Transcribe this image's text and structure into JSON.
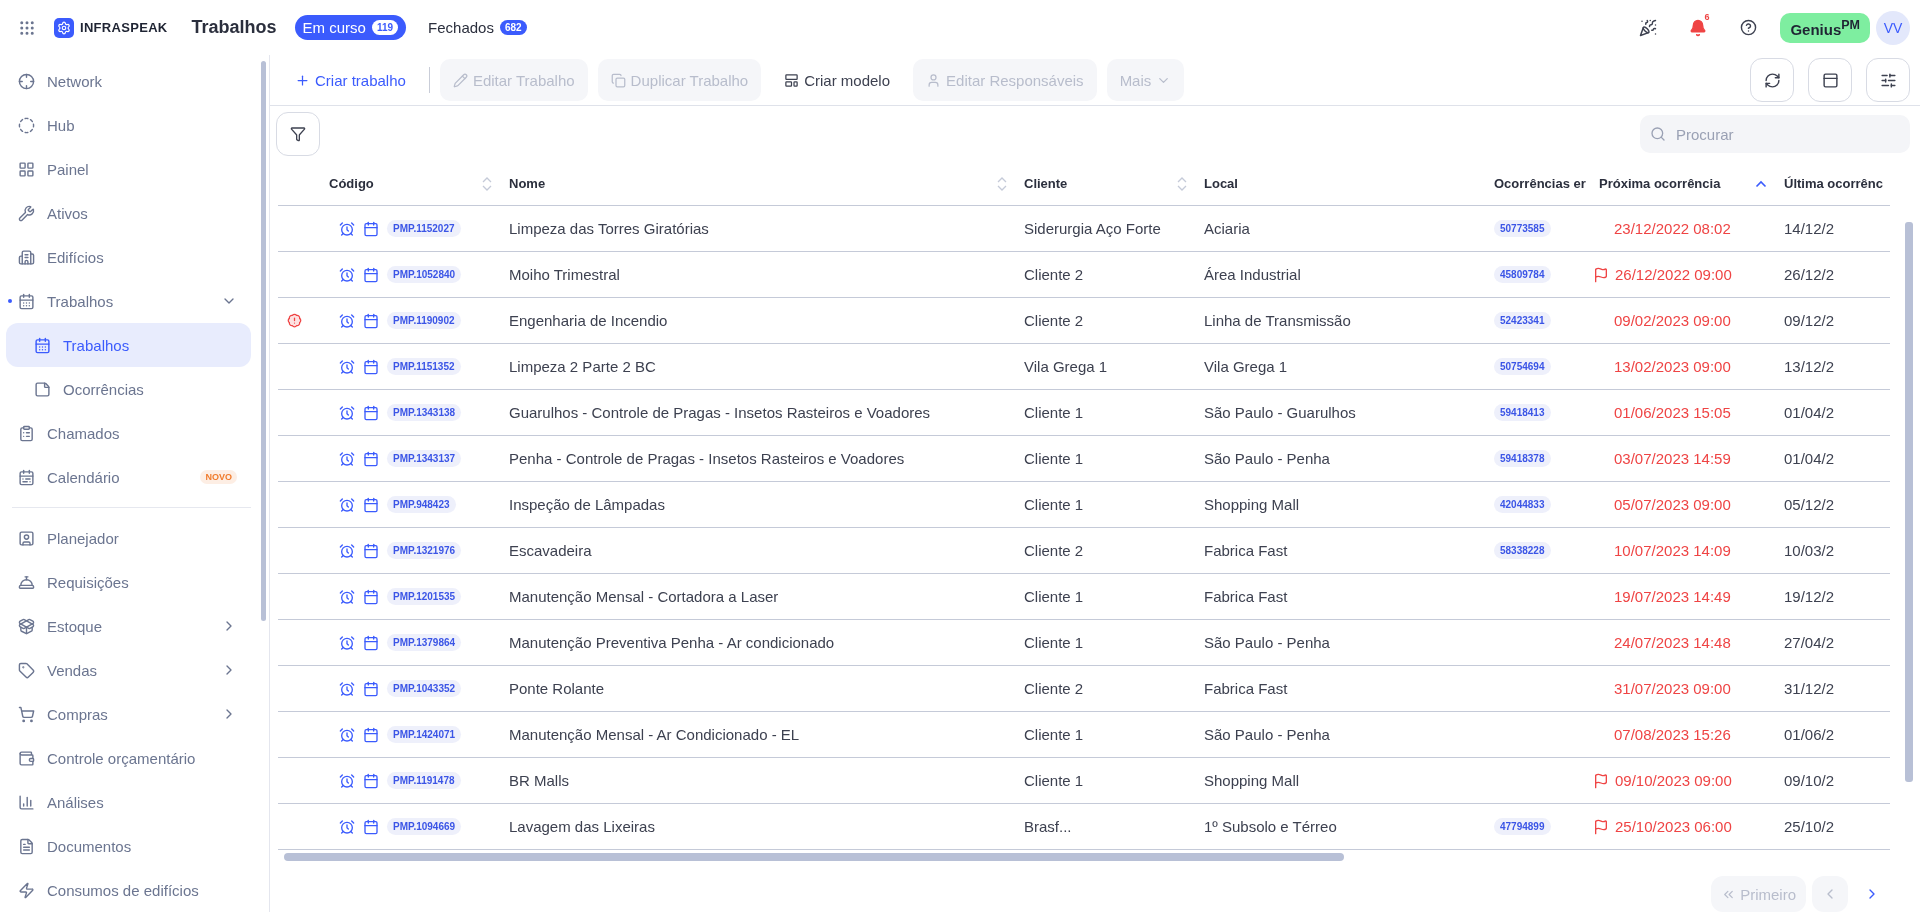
{
  "app": {
    "brand": "INFRASPEAK",
    "title": "Trabalhos"
  },
  "tabs": [
    {
      "label": "Em curso",
      "count": "119",
      "selected": true
    },
    {
      "label": "Fechados",
      "count": "682",
      "selected": false
    }
  ],
  "header_actions": {
    "notifications": "6",
    "plan": "Genius$^{PM}$",
    "avatar": "VV"
  },
  "sidebar": {
    "groups": [
      [
        {
          "label": "Network",
          "selected": false
        },
        {
          "label": "Hub",
          "selected": false
        },
        {
          "label": "Painel",
          "selected": false
        },
        {
          "label": "Ativos",
          "selected": false
        },
        {
          "label": "Edifícios",
          "selected": false
        },
        {
          "label": "Trabalhos",
          "selected": false,
          "expanded": true,
          "children": [
            {
              "label": "Trabalhos",
              "selected": true
            },
            {
              "label": "Ocorrências",
              "selected": false
            }
          ]
        },
        {
          "label": "Chamados",
          "selected": false
        },
        {
          "label": "Calendário",
          "selected": false,
          "badge": "NOVO"
        }
      ],
      [
        {
          "label": "Planejador",
          "selected": false
        },
        {
          "label": "Requisições",
          "selected": false
        },
        {
          "label": "Estoque",
          "selected": false,
          "expanded": false
        },
        {
          "label": "Vendas",
          "selected": false,
          "expanded": false
        },
        {
          "label": "Compras",
          "selected": false,
          "expanded": false
        },
        {
          "label": "Controle orçamentário",
          "selected": false
        },
        {
          "label": "Análises",
          "selected": false
        },
        {
          "label": "Documentos",
          "selected": false
        },
        {
          "label": "Consumos de edifícios",
          "selected": false
        }
      ]
    ]
  },
  "toolbar": [
    {
      "kind": "add",
      "label": "Criar trabalho",
      "disabled": false
    },
    {
      "kind": "edit",
      "label": "Editar Trabalho",
      "disabled": true
    },
    {
      "kind": "duplicate",
      "label": "Duplicar Trabalho",
      "disabled": true
    },
    {
      "kind": "template",
      "label": "Criar modelo",
      "disabled": false
    },
    {
      "kind": "assign",
      "label": "Editar Responsáveis",
      "disabled": true
    },
    {
      "kind": "more",
      "label": "Mais",
      "disabled": true
    }
  ],
  "search": {
    "placeholder": "Procurar"
  },
  "table": {
    "columns": [
      {
        "label": "Código",
        "sorted": false
      },
      {
        "label": "Nome",
        "sorted": false
      },
      {
        "label": "Cliente",
        "sorted": false
      },
      {
        "label": "Local"
      },
      {
        "label": "Ocorrências er"
      },
      {
        "label": "Próxima ocorrência",
        "sorted": true
      },
      {
        "label": "Última ocorrênc"
      }
    ],
    "rows": [
      {
        "alert": false,
        "code": "PMP.1152027",
        "name": "Limpeza das Torres Giratórias",
        "client": "Siderurgia Aço Forte",
        "location": "Aciaria",
        "occurrence": "50773585",
        "flagged": false,
        "next": "23/12/2022 08:02",
        "last": "14/12/2"
      },
      {
        "alert": false,
        "code": "PMP.1052840",
        "name": "Moiho Trimestral",
        "client": "Cliente 2",
        "location": "Área Industrial",
        "occurrence": "45809784",
        "flagged": true,
        "next": "26/12/2022 09:00",
        "last": "26/12/2"
      },
      {
        "alert": true,
        "code": "PMP.1190902",
        "name": "Engenharia de Incendio",
        "client": "Cliente 2",
        "location": "Linha de Transmissão",
        "occurrence": "52423341",
        "flagged": false,
        "next": "09/02/2023 09:00",
        "last": "09/12/2"
      },
      {
        "alert": false,
        "code": "PMP.1151352",
        "name": "Limpeza 2 Parte 2 BC",
        "client": "Vila Grega 1",
        "location": "Vila Grega 1",
        "occurrence": "50754694",
        "flagged": false,
        "next": "13/02/2023 09:00",
        "last": "13/12/2"
      },
      {
        "alert": false,
        "code": "PMP.1343138",
        "name": "Guarulhos - Controle de Pragas - Insetos Rasteiros e Voadores",
        "client": "Cliente 1",
        "location": "São Paulo - Guarulhos",
        "occurrence": "59418413",
        "flagged": false,
        "next": "01/06/2023 15:05",
        "last": "01/04/2"
      },
      {
        "alert": false,
        "code": "PMP.1343137",
        "name": "Penha - Controle de Pragas - Insetos Rasteiros e Voadores",
        "client": "Cliente 1",
        "location": "São Paulo - Penha",
        "occurrence": "59418378",
        "flagged": false,
        "next": "03/07/2023 14:59",
        "last": "01/04/2"
      },
      {
        "alert": false,
        "code": "PMP.948423",
        "name": "Inspeção de Lâmpadas",
        "client": "Cliente 1",
        "location": "Shopping Mall",
        "occurrence": "42044833",
        "flagged": false,
        "next": "05/07/2023 09:00",
        "last": "05/12/2"
      },
      {
        "alert": false,
        "code": "PMP.1321976",
        "name": "Escavadeira",
        "client": "Cliente 2",
        "location": "Fabrica Fast",
        "occurrence": "58338228",
        "flagged": false,
        "next": "10/07/2023 14:09",
        "last": "10/03/2"
      },
      {
        "alert": false,
        "code": "PMP.1201535",
        "name": "Manutenção Mensal - Cortadora a Laser",
        "client": "Cliente 1",
        "location": "Fabrica Fast",
        "flagged": false,
        "next": "19/07/2023 14:49",
        "last": "19/12/2"
      },
      {
        "alert": false,
        "code": "PMP.1379864",
        "name": "Manutenção Preventiva Penha - Ar condicionado",
        "client": "Cliente 1",
        "location": "São Paulo - Penha",
        "flagged": false,
        "next": "24/07/2023 14:48",
        "last": "27/04/2"
      },
      {
        "alert": false,
        "code": "PMP.1043352",
        "name": "Ponte Rolante",
        "client": "Cliente 2",
        "location": "Fabrica Fast",
        "flagged": false,
        "next": "31/07/2023 09:00",
        "last": "31/12/2"
      },
      {
        "alert": false,
        "code": "PMP.1424071",
        "name": "Manutenção Mensal - Ar Condicionado - EL",
        "client": "Cliente 1",
        "location": "São Paulo - Penha",
        "flagged": false,
        "next": "07/08/2023 15:26",
        "last": "01/06/2"
      },
      {
        "alert": false,
        "code": "PMP.1191478",
        "name": "BR Malls",
        "client": "Cliente 1",
        "location": "Shopping Mall",
        "flagged": true,
        "next": "09/10/2023 09:00",
        "last": "09/10/2"
      },
      {
        "alert": false,
        "code": "PMP.1094669",
        "name": "Lavagem das Lixeiras",
        "client": "Brasf...",
        "location": "1º Subsolo e Térreo",
        "occurrence": "47794899",
        "flagged": true,
        "next": "25/10/2023 06:00",
        "last": "25/10/2"
      }
    ]
  },
  "pagination": [
    {
      "kind": "first",
      "label": "Primeiro",
      "disabled": true
    },
    {
      "kind": "prev",
      "disabled": true
    },
    {
      "kind": "next",
      "disabled": false
    }
  ]
}
